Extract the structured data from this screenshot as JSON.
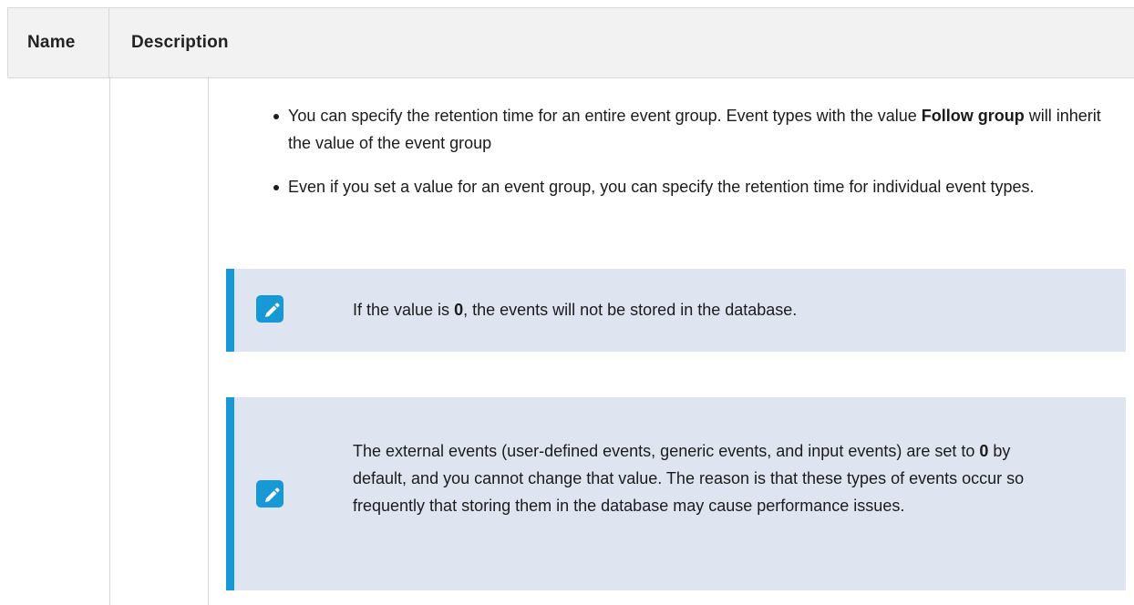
{
  "table": {
    "headers": {
      "name": "Name",
      "description": "Description"
    }
  },
  "bullets": [
    {
      "before": "You can specify the retention time for an entire event group. Event types with the value ",
      "bold": "Follow group",
      "after": " will inherit the value of the event group"
    },
    {
      "before": "Even if you set a value for an event group, you can specify the retention time for individual event types.",
      "bold": "",
      "after": ""
    }
  ],
  "notes": [
    {
      "icon": "pencil-note-icon",
      "before": "If the value is ",
      "bold": "0",
      "after": ", the events will not be stored in the database."
    },
    {
      "icon": "pencil-note-icon",
      "before": "The external events (user-defined events, generic events, and input events) are set to ",
      "bold": "0",
      "after": " by default, and you cannot change that value. The reason is that these types of events occur so frequently that storing them in the database may cause performance issues."
    }
  ],
  "colors": {
    "accent": "#1799d6",
    "note_background": "#dfe5f0",
    "header_background": "#f2f2f2"
  }
}
